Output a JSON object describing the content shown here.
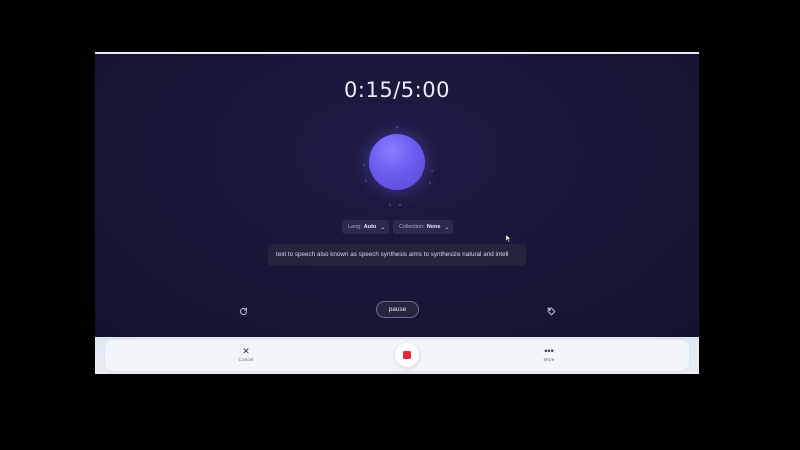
{
  "recorder": {
    "timer": "0:15/5:00",
    "lang": {
      "label": "Lang:",
      "value": "Auto"
    },
    "collection": {
      "label": "Collection:",
      "value": "None"
    },
    "transcript": "text to speech also known as speech synthesis aims to synthesize natural and intell",
    "pause_label": "pause",
    "icons": {
      "refresh": "refresh-icon",
      "tag": "tag-icon",
      "chevron": "chevron-down-icon"
    }
  },
  "bottom_bar": {
    "cancel_label": "Cancel",
    "more_label": "More",
    "stop_color": "#e0283c"
  },
  "colors": {
    "stage_bg": "#161638",
    "orb": "#6b5cf0",
    "bottom_bg": "#e9f0f5"
  }
}
